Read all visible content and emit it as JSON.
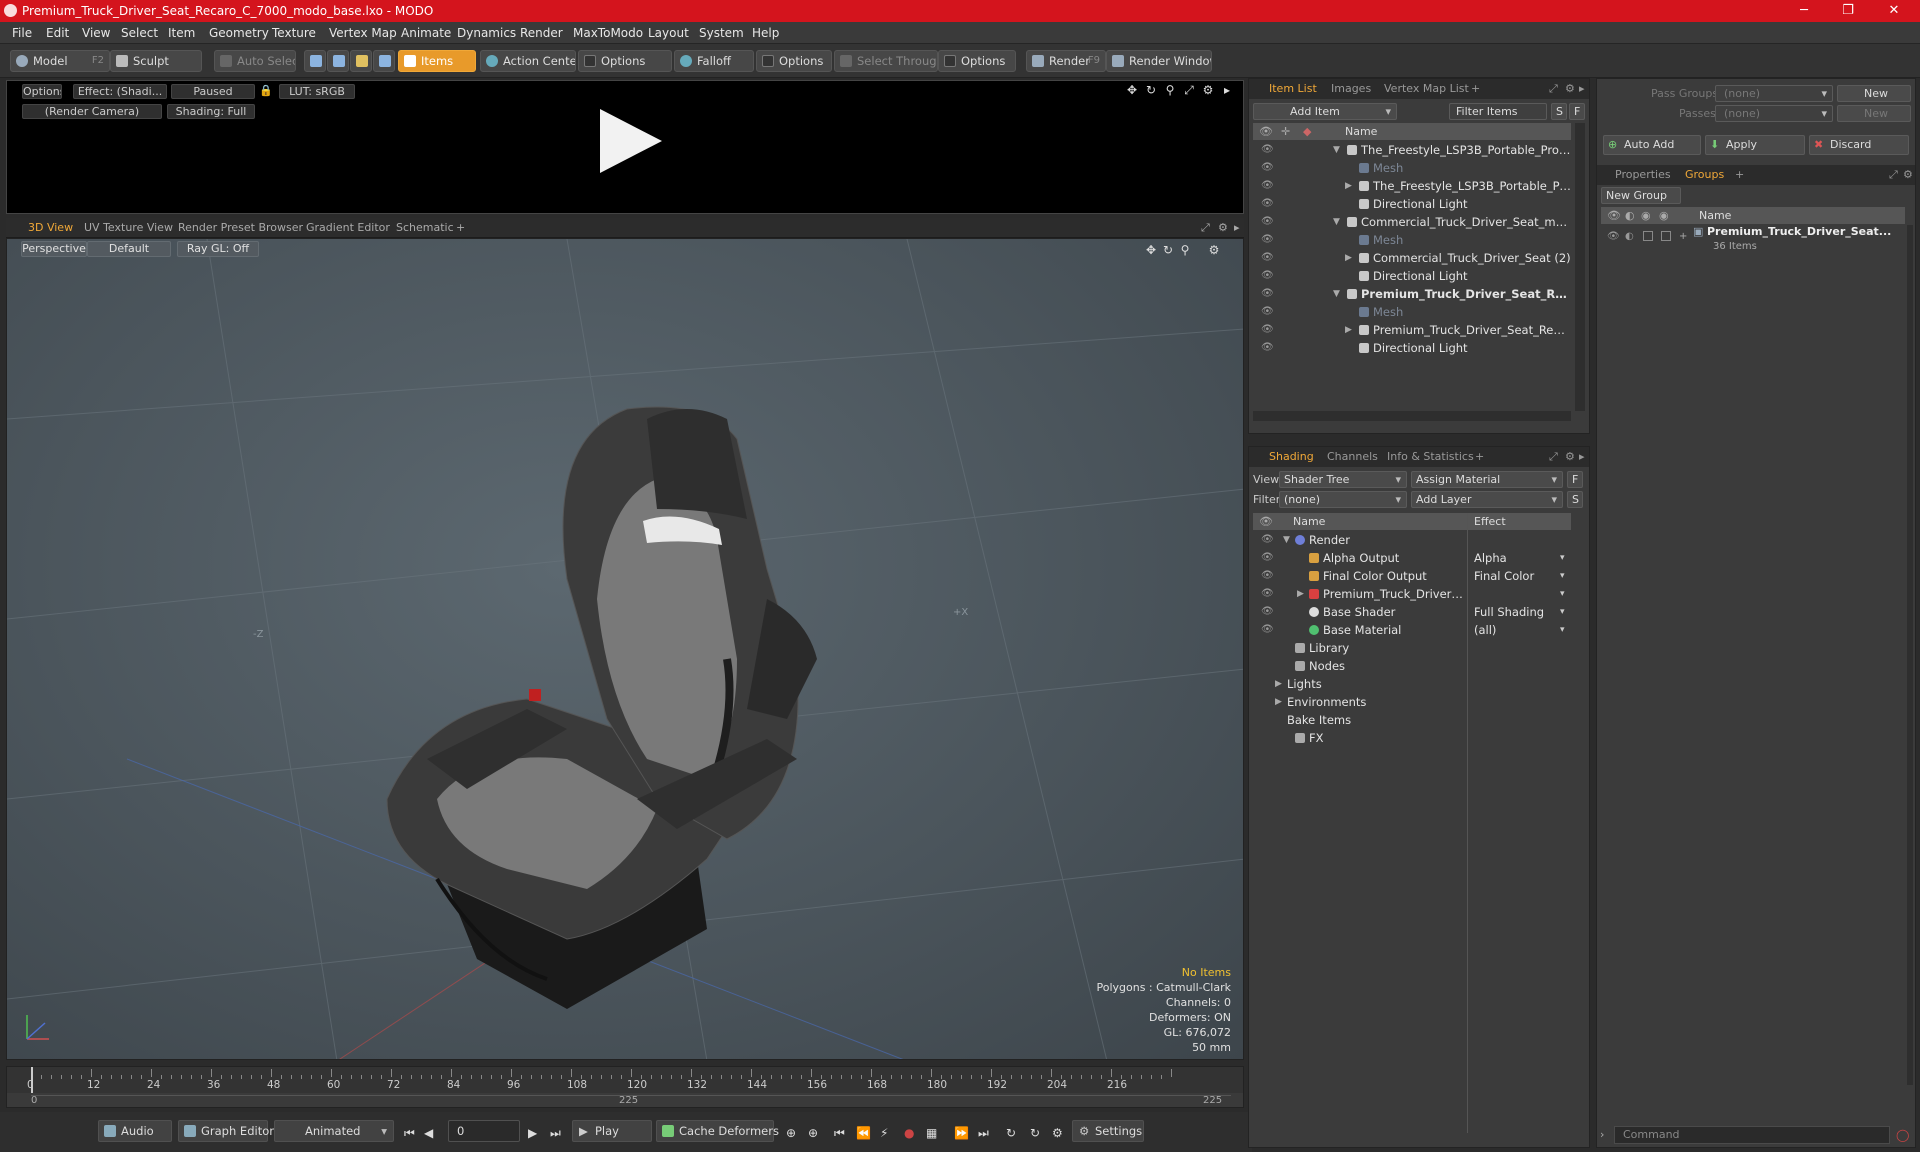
{
  "window": {
    "title": "Premium_Truck_Driver_Seat_Recaro_C_7000_modo_base.lxo - MODO",
    "minimize": "─",
    "maximize": "❐",
    "close": "✕"
  },
  "menu": [
    "File",
    "Edit",
    "View",
    "Select",
    "Item",
    "Geometry",
    "Texture",
    "Vertex Map",
    "Animate",
    "Dynamics",
    "Render",
    "MaxToModo",
    "Layout",
    "System",
    "Help"
  ],
  "toolbar": {
    "model": "Model",
    "model_key": "F2",
    "sculpt": "Sculpt",
    "auto_select": "Auto Select",
    "items": "Items",
    "action_center": "Action Center",
    "options1": "Options",
    "falloff": "Falloff",
    "options2": "Options",
    "select_through": "Select Through",
    "options3": "Options",
    "render": "Render",
    "render_key": "F9",
    "render_window": "Render Window"
  },
  "preview": {
    "options": "Options",
    "effect": "Effect: (Shadi...",
    "paused": "Paused",
    "lut": "LUT: sRGB",
    "camera": "(Render Camera)",
    "shading": "Shading: Full"
  },
  "viewport_tabs": [
    "3D View",
    "UV Texture View",
    "Render Preset Browser",
    "Gradient Editor",
    "Schematic",
    "+"
  ],
  "viewport": {
    "perspective": "Perspective",
    "default": "Default",
    "raygl": "Ray GL: Off",
    "stats": {
      "no_items": "No Items",
      "polygons": "Polygons : Catmull-Clark",
      "channels": "Channels: 0",
      "deformers": "Deformers: ON",
      "gl": "GL: 676,072",
      "mm": "50 mm"
    },
    "axis_z": "-Z",
    "axis_x": "+X"
  },
  "timeline": {
    "ticks": [
      "0",
      "12",
      "24",
      "36",
      "48",
      "60",
      "72",
      "84",
      "96",
      "108",
      "120",
      "132",
      "144",
      "156",
      "168",
      "180",
      "192",
      "204",
      "216"
    ],
    "start": "0",
    "mid": "225",
    "end": "225"
  },
  "transport": {
    "audio": "Audio",
    "graph_editor": "Graph Editor",
    "animated": "Animated",
    "frame": "0",
    "play": "Play",
    "cache": "Cache Deformers",
    "settings": "Settings"
  },
  "item_list": {
    "tabs": [
      "Item List",
      "Images",
      "Vertex Map List",
      "+"
    ],
    "add_item": "Add Item",
    "filter": "Filter Items",
    "btn_s": "S",
    "btn_f": "F",
    "col_name": "Name",
    "rows": [
      {
        "label": "The_Freestyle_LSP3B_Portable_Project ...",
        "style": "",
        "indent": 0,
        "arrow": "▼"
      },
      {
        "label": "Mesh",
        "style": "dim",
        "indent": 1,
        "arrow": ""
      },
      {
        "label": "The_Freestyle_LSP3B_Portable_Proje ...",
        "style": "",
        "indent": 1,
        "arrow": "▶"
      },
      {
        "label": "Directional Light",
        "style": "",
        "indent": 1,
        "arrow": ""
      },
      {
        "label": "Commercial_Truck_Driver_Seat_modo_b ...",
        "style": "",
        "indent": 0,
        "arrow": "▼"
      },
      {
        "label": "Mesh",
        "style": "dim",
        "indent": 1,
        "arrow": ""
      },
      {
        "label": "Commercial_Truck_Driver_Seat (2)",
        "style": "",
        "indent": 1,
        "arrow": "▶"
      },
      {
        "label": "Directional Light",
        "style": "",
        "indent": 1,
        "arrow": ""
      },
      {
        "label": "Premium_Truck_Driver_Seat_Rec...",
        "style": "bold",
        "indent": 0,
        "arrow": "▼"
      },
      {
        "label": "Mesh",
        "style": "dim",
        "indent": 1,
        "arrow": ""
      },
      {
        "label": "Premium_Truck_Driver_Seat_Recaro_ ...",
        "style": "",
        "indent": 1,
        "arrow": "▶"
      },
      {
        "label": "Directional Light",
        "style": "",
        "indent": 1,
        "arrow": ""
      }
    ]
  },
  "shading": {
    "tabs": [
      "Shading",
      "Channels",
      "Info & Statistics",
      "+"
    ],
    "view_label": "View",
    "view_value": "Shader Tree",
    "assign_material": "Assign Material",
    "filter_label": "Filter",
    "filter_value": "(none)",
    "add_layer": "Add Layer",
    "btn_f": "F",
    "btn_s": "S",
    "col_name": "Name",
    "col_effect": "Effect",
    "rows": [
      {
        "label": "Render",
        "effect": "",
        "indent": 0,
        "arrow": "▼",
        "icon": "#6f7fd8",
        "eye": true
      },
      {
        "label": "Alpha Output",
        "effect": "Alpha",
        "indent": 1,
        "arrow": "",
        "icon": "#d8a040",
        "eye": true
      },
      {
        "label": "Final Color Output",
        "effect": "Final Color",
        "indent": 1,
        "arrow": "",
        "icon": "#d8a040",
        "eye": true
      },
      {
        "label": "Premium_Truck_Driver_Se ...",
        "effect": "",
        "indent": 1,
        "arrow": "▶",
        "icon": "#d84040",
        "eye": true
      },
      {
        "label": "Base Shader",
        "effect": "Full Shading",
        "indent": 1,
        "arrow": "",
        "icon": "#dddddd",
        "eye": true
      },
      {
        "label": "Base Material",
        "effect": "(all)",
        "indent": 1,
        "arrow": "",
        "icon": "#50c070",
        "eye": true
      },
      {
        "label": "Library",
        "effect": "",
        "indent": 0,
        "arrow": "",
        "icon": "#aaaaaa",
        "eye": false
      },
      {
        "label": "Nodes",
        "effect": "",
        "indent": 0,
        "arrow": "",
        "icon": "#aaaaaa",
        "eye": false
      },
      {
        "label": "Lights",
        "effect": "",
        "indent": -1,
        "arrow": "▶",
        "icon": "",
        "eye": false
      },
      {
        "label": "Environments",
        "effect": "",
        "indent": -1,
        "arrow": "▶",
        "icon": "",
        "eye": false
      },
      {
        "label": "Bake Items",
        "effect": "",
        "indent": -1,
        "arrow": "",
        "icon": "",
        "eye": false
      },
      {
        "label": "FX",
        "effect": "",
        "indent": 0,
        "arrow": "",
        "icon": "#aaaaaa",
        "eye": false
      }
    ]
  },
  "groups": {
    "pass_groups": "Pass Groups",
    "pass_groups_value": "(none)",
    "passes": "Passes",
    "passes_value": "(none)",
    "new1": "New",
    "new2": "New",
    "auto_add": "Auto Add",
    "apply": "Apply",
    "discard": "Discard",
    "tabs": [
      "Properties",
      "Groups",
      "+"
    ],
    "new_group": "New Group",
    "col_name": "Name",
    "group_name": "Premium_Truck_Driver_Seat...",
    "group_count": "36 Items"
  },
  "command": {
    "placeholder": "Command"
  }
}
